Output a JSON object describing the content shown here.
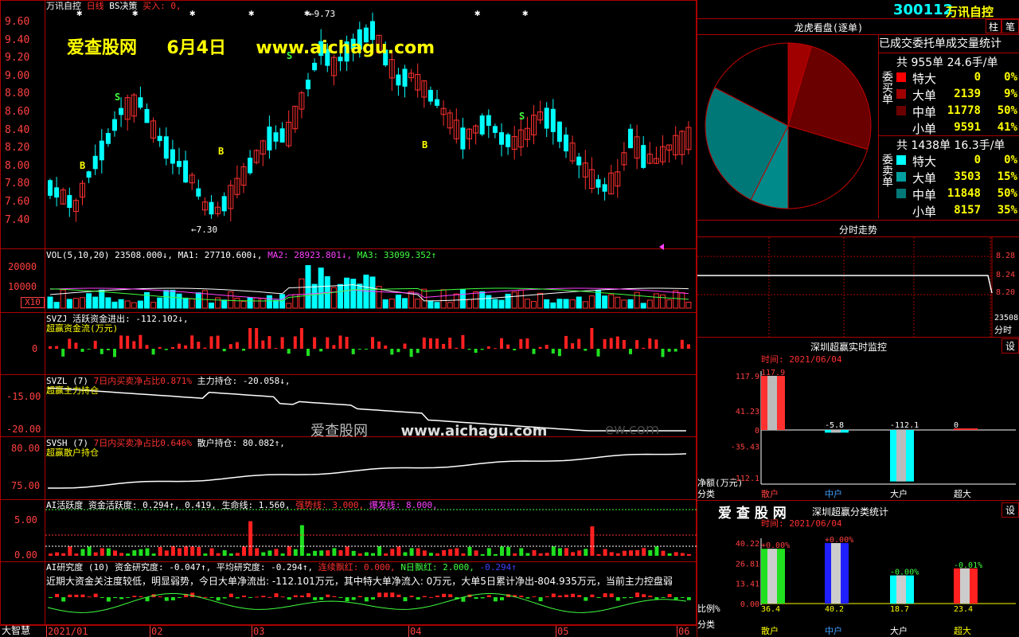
{
  "main": {
    "title_name": "万讯自控",
    "title_period": "日线",
    "title_indicator": "BS决策",
    "title_buy": "买入: 0,",
    "price_ticks": [
      "9.60",
      "9.40",
      "9.20",
      "9.00",
      "8.80",
      "8.60",
      "8.40",
      "8.20",
      "8.00",
      "7.80",
      "7.60",
      "7.40"
    ],
    "high_label": "9.73",
    "low_label": "7.30",
    "signal_b": "B",
    "signal_s": "S"
  },
  "watermark": {
    "site_name": "爱查股网",
    "date": "6月4日",
    "url": "www.aichagu.com",
    "mid_site": "爱查股网",
    "mid_url": "www.aichagu.com",
    "mid_tail": "ew.com"
  },
  "vol": {
    "label": "VOL(5,10,20)",
    "value": "23508.000↓,",
    "ma1": "MA1: 27710.600↓,",
    "ma2": "MA2: 28923.801↓,",
    "ma3": "MA3: 33099.352↑",
    "ticks": [
      "20000",
      "10000"
    ],
    "unit": "X10"
  },
  "svzj": {
    "label": "SVZJ",
    "desc": "活跃资金进出: -112.102↓,",
    "sub": "超赢资金流(万元)",
    "tick": "0"
  },
  "svzl": {
    "label": "SVZL (7)",
    "desc": "7日内买卖净占比0.871%",
    "desc2": "主力持仓: -20.058↓,",
    "sub": "超赢主力持仓",
    "ticks": [
      "-15.00",
      "-20.00"
    ]
  },
  "svsh": {
    "label": "SVSH (7)",
    "desc": "7日内买卖净占比0.646%",
    "desc2": "散户持仓: 80.082↑,",
    "sub": "超赢散户持仓",
    "ticks": [
      "80.00",
      "75.00"
    ]
  },
  "ai_active": {
    "label": "AI活跃度",
    "v1": "资金活跃度: 0.294↑,",
    "v2": "0.419,",
    "v3": "生命线: 1.560,",
    "v4": "强势线: 3.000,",
    "v5": "爆发线: 8.000,",
    "ticks": [
      "5.00",
      "0.00"
    ]
  },
  "ai_research": {
    "label": "AI研究度 (10)",
    "v1": "资金研究度: -0.047↑,",
    "v2": "平均研究度: -0.294↑,",
    "v3": "连续飘红: 0.000,",
    "v4": "N日飘红: 2.000,",
    "v5": "-0.294↑",
    "commentary": "近期大资金关注度较低，明显弱势，今日大单净流出: -112.101万元，其中特大单净流入: 0万元，大单5日累计净出-804.935万元，当前主力控盘弱"
  },
  "bottom": {
    "brand": "大智慧",
    "dates": [
      "2021/01",
      "02",
      "03",
      "04",
      "05",
      "06"
    ]
  },
  "right": {
    "code": "300112",
    "name": "万讯自控",
    "btn_bar": "柱",
    "btn_pen": "笔",
    "longhu_title": "龙虎看盘(逐单)",
    "stats_title": "已成交委托单成交量统计",
    "buy_side": "委买单",
    "sell_side": "委卖单",
    "buy_total": "共 955单 24.6手/单",
    "sell_total": "共 1438单 16.3手/单",
    "buy_rows": [
      {
        "label": "特大",
        "value": "0",
        "pct": "0%",
        "color": "#ff0000"
      },
      {
        "label": "大单",
        "value": "2139",
        "pct": "9%",
        "color": "#a00000"
      },
      {
        "label": "中单",
        "value": "11778",
        "pct": "50%",
        "color": "#6a0000"
      },
      {
        "label": "小单",
        "value": "9591",
        "pct": "41%",
        "color": "#000000"
      }
    ],
    "sell_rows": [
      {
        "label": "特大",
        "value": "0",
        "pct": "0%",
        "color": "#00ffff"
      },
      {
        "label": "大单",
        "value": "3503",
        "pct": "15%",
        "color": "#00a0a0"
      },
      {
        "label": "中单",
        "value": "11848",
        "pct": "50%",
        "color": "#007878"
      },
      {
        "label": "小单",
        "value": "8157",
        "pct": "35%",
        "color": "#000000"
      }
    ],
    "fenshi_title": "分时走势",
    "fenshi_ticks": [
      "8.28",
      "8.24",
      "8.20"
    ],
    "fenshi_vol": "23508",
    "fenshi_label": "分时",
    "monitor_title": "深圳超赢实时监控",
    "monitor_btn": "设",
    "monitor_time": "时间: 2021/06/04",
    "monitor_ticks": [
      "117.9",
      "41.23",
      "0",
      "-35.43",
      "-112.1"
    ],
    "monitor_values": [
      "117.9",
      "-5.8",
      "-112.1",
      "0"
    ],
    "monitor_cats": [
      "散户",
      "中户",
      "大户",
      "超大"
    ],
    "monitor_ylabel": "净额(万元)",
    "monitor_xlabel": "分类",
    "classify_brand": "爱 查 股 网",
    "classify_title": "深圳超赢分类统计",
    "classify_btn": "设",
    "classify_time": "时间: 2021/06/04",
    "classify_ticks": [
      "40.22",
      "26.81",
      "13.41",
      "0.00"
    ],
    "classify_changes": [
      "+0.00%",
      "+0.00%",
      "-0.00%",
      "-0.01%"
    ],
    "classify_values": [
      "36.4",
      "40.2",
      "18.7",
      "23.4"
    ],
    "classify_ylabel": "比例%",
    "classify_xlabel": "分类",
    "classify_cats": [
      "散户",
      "中户",
      "大户",
      "超大"
    ]
  },
  "chart_data": [
    {
      "type": "pie",
      "title": "龙虎看盘(逐单)",
      "categories": [
        "买特大",
        "买大单",
        "买中单",
        "买小单",
        "卖特大",
        "卖大单",
        "卖中单",
        "卖小单"
      ],
      "values": [
        0,
        2139,
        11778,
        9591,
        0,
        3503,
        11848,
        8157
      ]
    },
    {
      "type": "bar",
      "title": "深圳超赢实时监控",
      "categories": [
        "散户",
        "中户",
        "大户",
        "超大"
      ],
      "values": [
        117.9,
        -5.8,
        -112.1,
        0
      ],
      "ylabel": "净额(万元)",
      "xlabel": "分类",
      "ylim": [
        -112.1,
        117.9
      ]
    },
    {
      "type": "bar",
      "title": "深圳超赢分类统计",
      "categories": [
        "散户",
        "中户",
        "大户",
        "超大"
      ],
      "values": [
        36.4,
        40.2,
        18.7,
        23.4
      ],
      "ylabel": "比例%",
      "xlabel": "分类",
      "ylim": [
        0,
        40.22
      ]
    }
  ]
}
